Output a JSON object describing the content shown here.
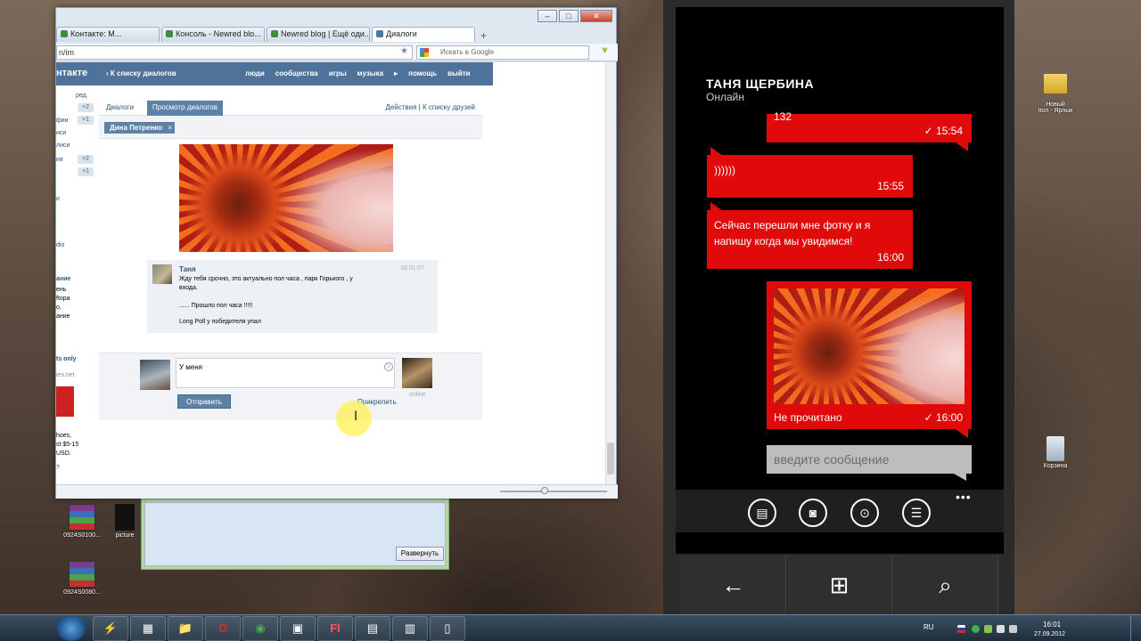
{
  "browser": {
    "tabs": [
      "Контакте: М...",
      "Консоль - Newred blo...",
      "Newred blog | Ещё оди...",
      "Диалоги"
    ],
    "new_tab": "+",
    "address": "n/im",
    "search_placeholder": "Искать в Google",
    "controls": {
      "minimize": "–",
      "maximize": "□",
      "close": "✕"
    }
  },
  "vk": {
    "logo": "нтакте",
    "back_link": "‹ К списку диалогов",
    "menu": [
      "люди",
      "сообщества",
      "игры",
      "музыка",
      "▸",
      "помощь",
      "выйти"
    ],
    "left_col": {
      "items": [
        "ред.",
        "фии",
        "иси",
        "лиси",
        "ия",
        "и",
        "dio",
        "ание",
        "ень",
        "ftopa",
        "о,",
        "ание",
        "ts only",
        "ies.net",
        "hoes,",
        "st $5-15",
        "USD.",
        "?"
      ],
      "counts": [
        "+2",
        "+1",
        "+2",
        "+1"
      ]
    },
    "dialog": {
      "tab_dialogs": "Диалоги",
      "tab_view": "Просмотр диалогов",
      "actions": "Действия  |  К списку друзей",
      "chip": "Дина Петренко",
      "chip_close": "×",
      "message": {
        "name": "Таня",
        "time": "16:01:07",
        "lines": [
          "Жду тебя срочно, это актуально пол часа , парк Горького , у",
          "входа.",
          "...... Прошло пол часа !!!!!",
          "Long Poll у победителя упал"
        ]
      },
      "compose_text": "У меня",
      "send": "Отправить",
      "attach": "Прикрепить",
      "online": "online"
    }
  },
  "window2": {
    "expand_button": "Развернуть"
  },
  "desktop_icons": {
    "left": [
      {
        "label": "0924S0100..."
      },
      {
        "label": "picture"
      },
      {
        "label": "0924S0080..."
      }
    ],
    "new_folder": "Новый\nпол - Ярлык",
    "trash": "Корзина"
  },
  "phone": {
    "contact_name": "ТАНЯ ЩЕРБИНА",
    "status": "Онлайн",
    "messages": [
      {
        "text": "132",
        "time": "15:54",
        "direction": "out",
        "read": true
      },
      {
        "text": "))))))",
        "time": "15:55",
        "direction": "in"
      },
      {
        "text": "Сейчас перешли мне фотку и я\nнапишу когда мы увидимся!",
        "time": "16:00",
        "direction": "in"
      },
      {
        "text": "Не прочитано",
        "time": "16:00",
        "direction": "out",
        "photo": true,
        "read": true
      }
    ],
    "checkmark": "✓",
    "input_placeholder": "введите сообщение",
    "appbar": [
      "chat-icon",
      "camera-icon",
      "location-icon",
      "list-icon"
    ],
    "more": "•••",
    "hardware": [
      "←",
      "⊞",
      "⌕"
    ],
    "accent": "#e10a0a"
  },
  "taskbar": {
    "lang": "RU",
    "time": "16:01",
    "date": "27.09.2012",
    "apps": [
      "⚡",
      "▦",
      "📁",
      "O",
      "◉",
      "▣",
      "Fl",
      "▤",
      "▥",
      "▯"
    ]
  }
}
